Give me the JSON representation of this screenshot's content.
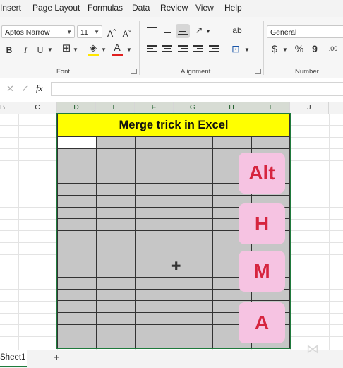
{
  "menu": [
    "Insert",
    "Page Layout",
    "Formulas",
    "Data",
    "Review",
    "View",
    "Help"
  ],
  "ribbon": {
    "font_name": "Aptos Narrow",
    "font_size": "11",
    "grow_font": "A^",
    "shrink_font": "A˅",
    "bold": "B",
    "italic": "I",
    "underline": "U",
    "font_color_glyph": "A",
    "number_format": "General",
    "currency": "$",
    "percent": "%",
    "comma": "9",
    "groups": {
      "font": "Font",
      "alignment": "Alignment",
      "number": "Number"
    }
  },
  "formula_bar": {
    "cancel": "✕",
    "enter": "✓",
    "fx": "fx",
    "value": ""
  },
  "columns": [
    "C",
    "D",
    "E",
    "F",
    "G",
    "H",
    "I",
    "J"
  ],
  "partial_column": "B",
  "title_cell": "Merge trick in Excel",
  "keys": [
    "Alt",
    "H",
    "M",
    "A"
  ],
  "sheet_tab": "Sheet1",
  "add_sheet": "+",
  "colors": {
    "title_fill": "#ffff00",
    "block_fill": "#c6c6c6",
    "key_fill": "#f6c3e2",
    "key_text": "#d6243f",
    "excel_green": "#1f7a3c"
  }
}
